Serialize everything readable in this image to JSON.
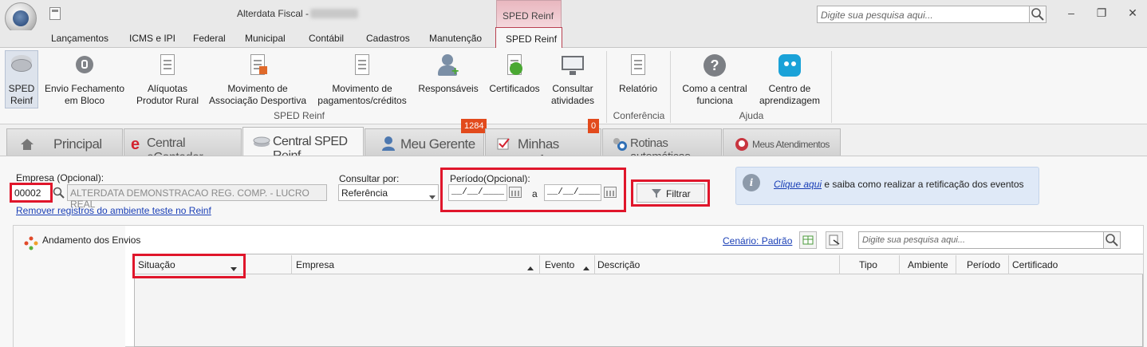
{
  "titlebar": {
    "app_title": "Alterdata Fiscal -",
    "context_tab": "SPED Reinf",
    "search_placeholder": "Digite sua pesquisa aqui..."
  },
  "menu": {
    "items": [
      "Lançamentos",
      "ICMS e IPI",
      "Federal",
      "Municipal",
      "Contábil",
      "Cadastros",
      "Manutenção",
      "SPED Reinf"
    ]
  },
  "ribbon": {
    "buttons": [
      {
        "l1": "SPED",
        "l2": "Reinf"
      },
      {
        "l1": "Envio Fechamento",
        "l2": "em Bloco"
      },
      {
        "l1": "Alíquotas",
        "l2": "Produtor Rural"
      },
      {
        "l1": "Movimento de",
        "l2": "Associação Desportiva"
      },
      {
        "l1": "Movimento de",
        "l2": "pagamentos/créditos"
      },
      {
        "l1": "Responsáveis",
        "l2": ""
      },
      {
        "l1": "Certificados",
        "l2": ""
      },
      {
        "l1": "Consultar",
        "l2": "atividades"
      },
      {
        "l1": "Relatório",
        "l2": ""
      },
      {
        "l1": "Como a central",
        "l2": "funciona"
      },
      {
        "l1": "Centro de",
        "l2": "aprendizagem"
      }
    ],
    "groups": [
      "SPED Reinf",
      "Conferência",
      "Ajuda"
    ]
  },
  "tabs": [
    {
      "label": "Principal"
    },
    {
      "label": "Central eContador"
    },
    {
      "label": "Central SPED Reinf"
    },
    {
      "label": "Meu Gerente",
      "badge": "1284"
    },
    {
      "label": "Minhas tarefas",
      "badge": "0"
    },
    {
      "label": "Rotinas automáticas"
    },
    {
      "label": "Meus Atendimentos"
    }
  ],
  "form": {
    "empresa_label": "Empresa (Opcional):",
    "empresa_code": "00002",
    "empresa_name": "ALTERDATA DEMONSTRACAO REG. COMP. - LUCRO REAL",
    "remove_link": "Remover registros do ambiente teste no Reinf",
    "consultar_label": "Consultar por:",
    "consultar_value": "Referência",
    "periodo_label": "Período(Opcional):",
    "date_from": "__/__/____",
    "date_sep": "a",
    "date_to": "__/__/____",
    "filter_button": "Filtrar"
  },
  "info": {
    "link": "Clique aqui",
    "text": " e saiba como realizar a retificação dos eventos"
  },
  "panel": {
    "title": "Andamento dos Envios",
    "scenario_link": "Cenário: Padrão",
    "search_placeholder": "Digite sua pesquisa aqui...",
    "columns": [
      "Situação",
      "Empresa",
      "Evento",
      "Descrição",
      "Tipo",
      "Ambiente",
      "Período",
      "Certificado"
    ]
  },
  "colors": {
    "accent_red": "#e0162b",
    "badge": "#e24a1c",
    "link": "#1a3fb6"
  }
}
